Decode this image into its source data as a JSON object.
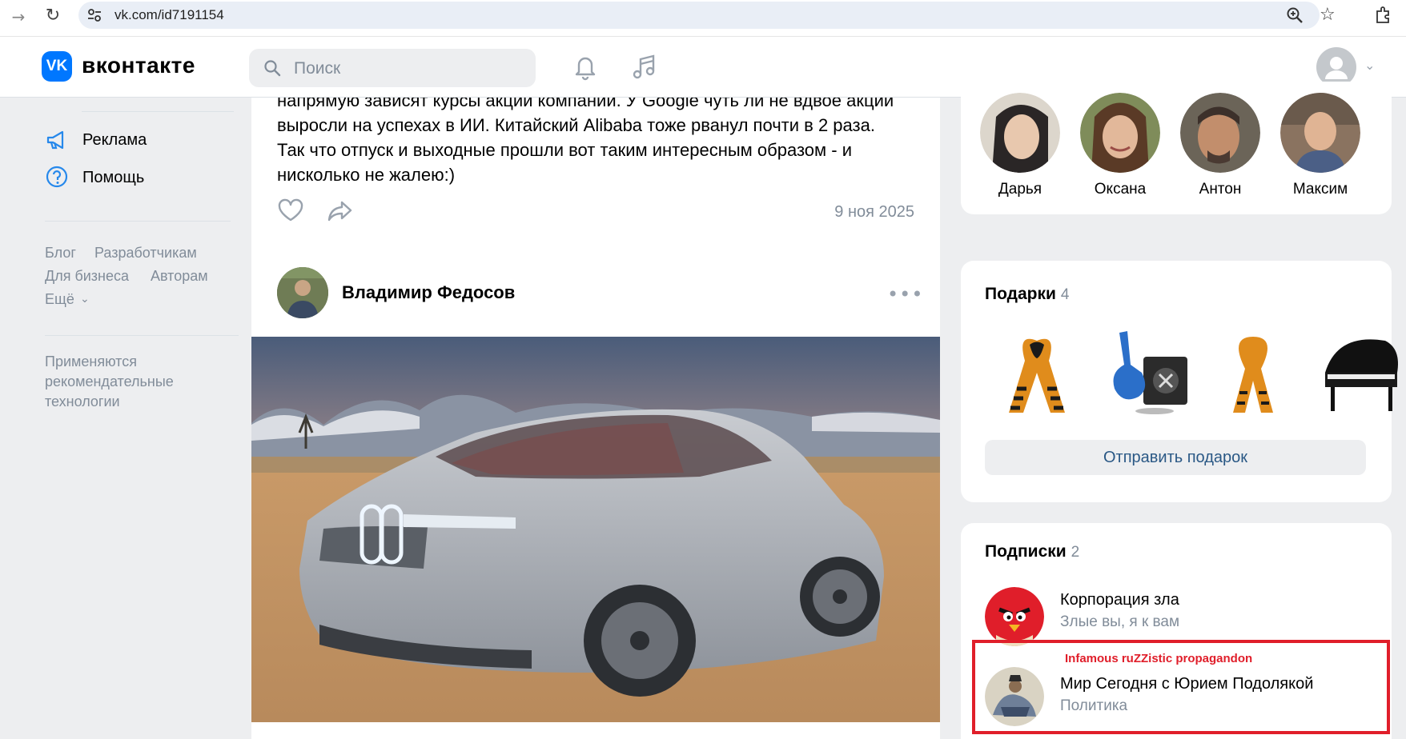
{
  "browser": {
    "url": "vk.com/id7191154"
  },
  "header": {
    "logo_letters": "VK",
    "wordmark": "вконтакте",
    "search_placeholder": "Поиск"
  },
  "leftnav": {
    "items": [
      {
        "label": "Реклама",
        "icon": "megaphone-icon"
      },
      {
        "label": "Помощь",
        "icon": "help-circle-icon"
      }
    ],
    "footer_links": [
      "Блог",
      "Разработчикам",
      "Для бизнеса",
      "Авторам",
      "Ещё"
    ],
    "recommendation_note": "Применяются рекомендательные технологии"
  },
  "feed": {
    "previous_post": {
      "text_lines": [
        "напрямую зависят курсы акции компании. У Google чуть ли не вдвое акции",
        "выросли на успехах в ИИ. Китайский Alibaba тоже рванул почти в 2 раза.",
        "Так что отпуск и выходные прошли вот таким интересным образом - и",
        "нисколько не жалею:)"
      ],
      "date": "9 ноя 2025"
    },
    "post": {
      "author": "Владимир Федосов",
      "more": "•••",
      "image": "concept car photo on desert road"
    }
  },
  "friends": [
    {
      "name": "Дарья"
    },
    {
      "name": "Оксана"
    },
    {
      "name": "Антон"
    },
    {
      "name": "Максим"
    }
  ],
  "gifts": {
    "title": "Подарки",
    "count": "4",
    "items": [
      "st-george-ribbon",
      "guitar-amp",
      "ribbon-bow",
      "grand-piano"
    ],
    "send_button": "Отправить подарок"
  },
  "subscriptions": {
    "title": "Подписки",
    "count": "2",
    "items": [
      {
        "name": "Корпорация зла",
        "category": "Злые вы, я к вам"
      },
      {
        "name": "Мир Сегодня с Юрием Подолякой",
        "category": "Политика"
      }
    ],
    "annotation": "Infamous ruZZistic propagandon"
  },
  "colors": {
    "vk_blue": "#0077ff",
    "link": "#2a5885",
    "muted": "#818c99",
    "highlight_red": "#e01e2a",
    "page_bg": "#edeef0"
  }
}
